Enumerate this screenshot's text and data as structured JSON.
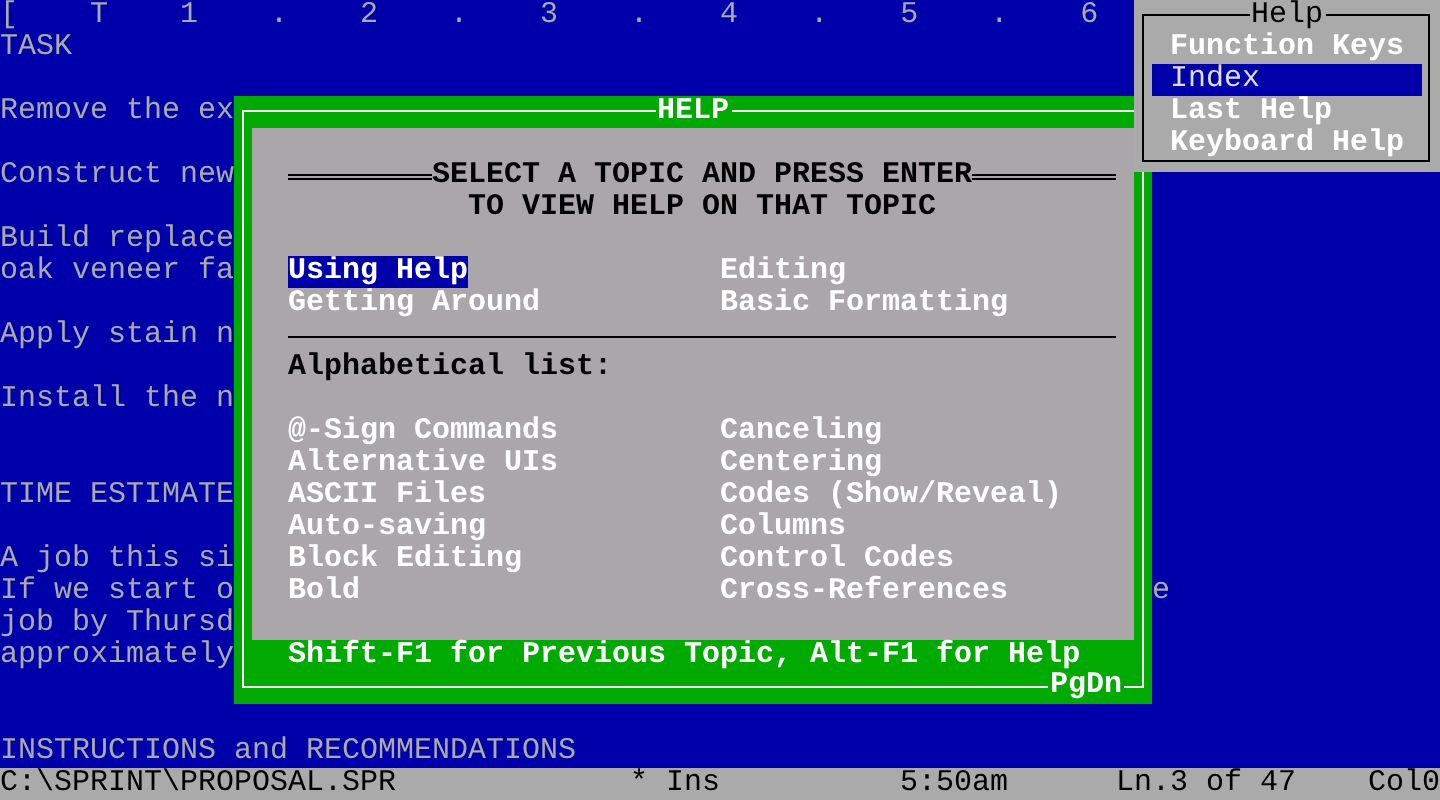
{
  "editor": {
    "ruler": "[    T    1    .    2    .    3    .    4    .    5    .    6",
    "blocks": [
      {
        "kind": "heading",
        "lines": [
          "TASK"
        ]
      },
      {
        "kind": "paragraph",
        "lines": [
          "Remove the ex"
        ]
      },
      {
        "kind": "paragraph",
        "lines": [
          "Construct new"
        ]
      },
      {
        "kind": "paragraph",
        "lines": [
          "Build replace",
          "oak veneer fa"
        ]
      },
      {
        "kind": "paragraph",
        "lines": [
          "Apply stain n"
        ]
      },
      {
        "kind": "paragraph",
        "lines": [
          "Install the n"
        ]
      },
      {
        "kind": "heading",
        "lines": [
          "TIME ESTIMATE"
        ]
      },
      {
        "kind": "paragraph",
        "lines": [
          "A job this si",
          "If we start o",
          "job by Thursd",
          "approximately"
        ]
      },
      {
        "kind": "fragment",
        "lines": [
          "e"
        ]
      },
      {
        "kind": "heading",
        "lines": [
          "INSTRUCTIONS and RECOMMENDATIONS"
        ]
      }
    ]
  },
  "help_dialog": {
    "title": "HELP",
    "heading": [
      "SELECT A TOPIC AND PRESS ENTER",
      "TO VIEW HELP ON THAT TOPIC"
    ],
    "topics": [
      {
        "label": "Using Help",
        "selected": true
      },
      {
        "label": "Editing",
        "selected": false
      },
      {
        "label": "Getting Around",
        "selected": false
      },
      {
        "label": "Basic Formatting",
        "selected": false
      }
    ],
    "list_label": "Alphabetical list:",
    "index_items": [
      "@-Sign Commands",
      "Alternative UIs",
      "ASCII Files",
      "Auto-saving",
      "Block Editing",
      "Bold",
      "Canceling",
      "Centering",
      "Codes (Show/Reveal)",
      "Columns",
      "Control Codes",
      "Cross-References"
    ],
    "footer": "Shift-F1 for Previous Topic, Alt-F1 for Help",
    "page_hint": "PgDn"
  },
  "help_menu": {
    "title": "Help",
    "items": [
      {
        "label": "Function Keys",
        "selected": false
      },
      {
        "label": "Index",
        "selected": true
      },
      {
        "label": "Last Help",
        "selected": false
      },
      {
        "label": "Keyboard Help",
        "selected": false
      }
    ]
  },
  "status_bar": {
    "file": "C:\\SPRINT\\PROPOSAL.SPR",
    "mode": "* Ins",
    "time": "5:50am",
    "line": "Ln.3 of 47",
    "column": "Col0"
  }
}
